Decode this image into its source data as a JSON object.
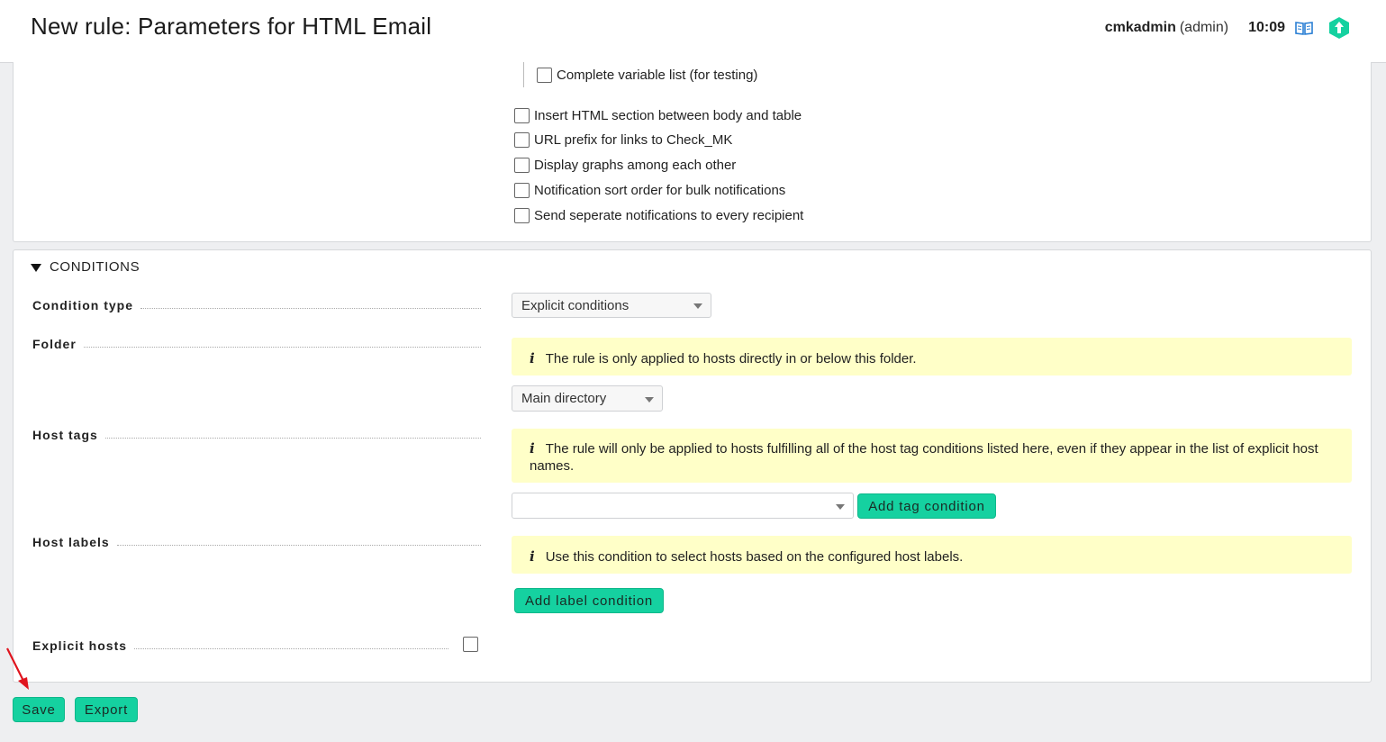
{
  "header": {
    "title": "New rule: Parameters for HTML Email",
    "username": "cmkadmin",
    "role": "(admin)",
    "time": "10:09",
    "icons": {
      "help": "book-icon",
      "brand": "checkmk-logo-icon"
    },
    "accent_color": "#15d1a0"
  },
  "options": {
    "complete_variable_list": "Complete variable list (for testing)",
    "items": [
      "Insert HTML section between body and table",
      "URL prefix for links to Check_MK",
      "Display graphs among each other",
      "Notification sort order for bulk notifications",
      "Send seperate notifications to every recipient"
    ]
  },
  "conditions": {
    "section_title": "CONDITIONS",
    "condition_type": {
      "label": "Condition type",
      "value": "Explicit conditions"
    },
    "folder": {
      "label": "Folder",
      "help": "The rule is only applied to hosts directly in or below this folder.",
      "value": "Main directory"
    },
    "host_tags": {
      "label": "Host tags",
      "help": "The rule will only be applied to hosts fulfilling all of the host tag conditions listed here, even if they appear in the list of explicit host names.",
      "value": "",
      "button": "Add tag condition"
    },
    "host_labels": {
      "label": "Host labels",
      "help": "Use this condition to select hosts based on the configured host labels.",
      "button": "Add label condition"
    },
    "explicit_hosts": {
      "label": "Explicit hosts"
    }
  },
  "footer": {
    "save": "Save",
    "export": "Export"
  }
}
